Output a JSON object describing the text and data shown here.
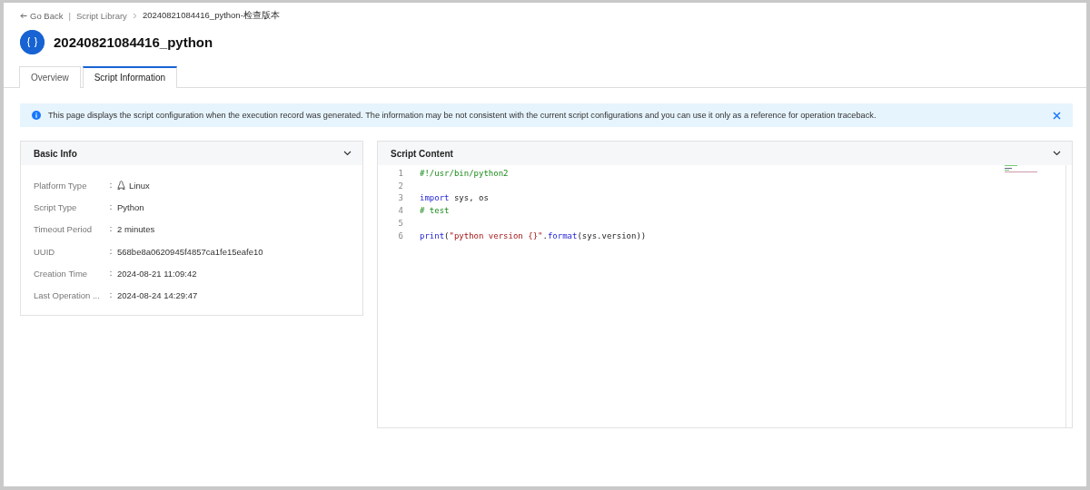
{
  "breadcrumb": {
    "back": "Go Back",
    "separator": "|",
    "items": [
      "Script Library",
      "20240821084416_python-检查版本"
    ]
  },
  "title": "20240821084416_python",
  "tabs": [
    {
      "label": "Overview",
      "selected": false
    },
    {
      "label": "Script Information",
      "selected": true
    }
  ],
  "notice": {
    "text": "This page displays the script configuration when the execution record was generated. The information may be not consistent with the current script configurations and you can use it only as a reference for operation traceback."
  },
  "basic_info": {
    "title": "Basic Info",
    "expanded": true,
    "fields": [
      {
        "label": "Platform Type",
        "colon": "：",
        "value": "Linux",
        "kind": "platform"
      },
      {
        "label": "Script Type",
        "colon": "：",
        "value": "Python",
        "kind": "text"
      },
      {
        "label": "Timeout Period",
        "colon": "：",
        "value": "2 minutes",
        "kind": "text"
      },
      {
        "label": "UUID",
        "colon": "：",
        "value": "568be8a0620945f4857ca1fe15eafe10",
        "kind": "text"
      },
      {
        "label": "Creation Time",
        "colon": "：",
        "value": "2024-08-21 11:09:42",
        "kind": "text"
      },
      {
        "label": "Last Operation ...",
        "colon": "：",
        "value": "2024-08-24 14:29:47",
        "kind": "text"
      }
    ]
  },
  "script_content": {
    "title": "Script Content",
    "expanded": true,
    "lines": [
      {
        "number": "1",
        "tokens": [
          {
            "kind": "comment",
            "text": "#!/usr/bin/python2"
          }
        ]
      },
      {
        "number": "2"
      },
      {
        "number": "3",
        "tokens": [
          {
            "kind": "keyword",
            "text": "import"
          },
          {
            "kind": "plain",
            "text": " sys, os"
          }
        ]
      },
      {
        "number": "4",
        "tokens": [
          {
            "kind": "comment",
            "text": "# test"
          }
        ]
      },
      {
        "number": "5"
      },
      {
        "number": "6",
        "tokens": [
          {
            "kind": "keyword",
            "text": "print"
          },
          {
            "kind": "plain",
            "text": "("
          },
          {
            "kind": "string",
            "text": "\"python version {}\""
          },
          {
            "kind": "plain",
            "text": "."
          },
          {
            "kind": "keyword",
            "text": "format"
          },
          {
            "kind": "plain",
            "text": "(sys.version))"
          }
        ]
      }
    ]
  }
}
